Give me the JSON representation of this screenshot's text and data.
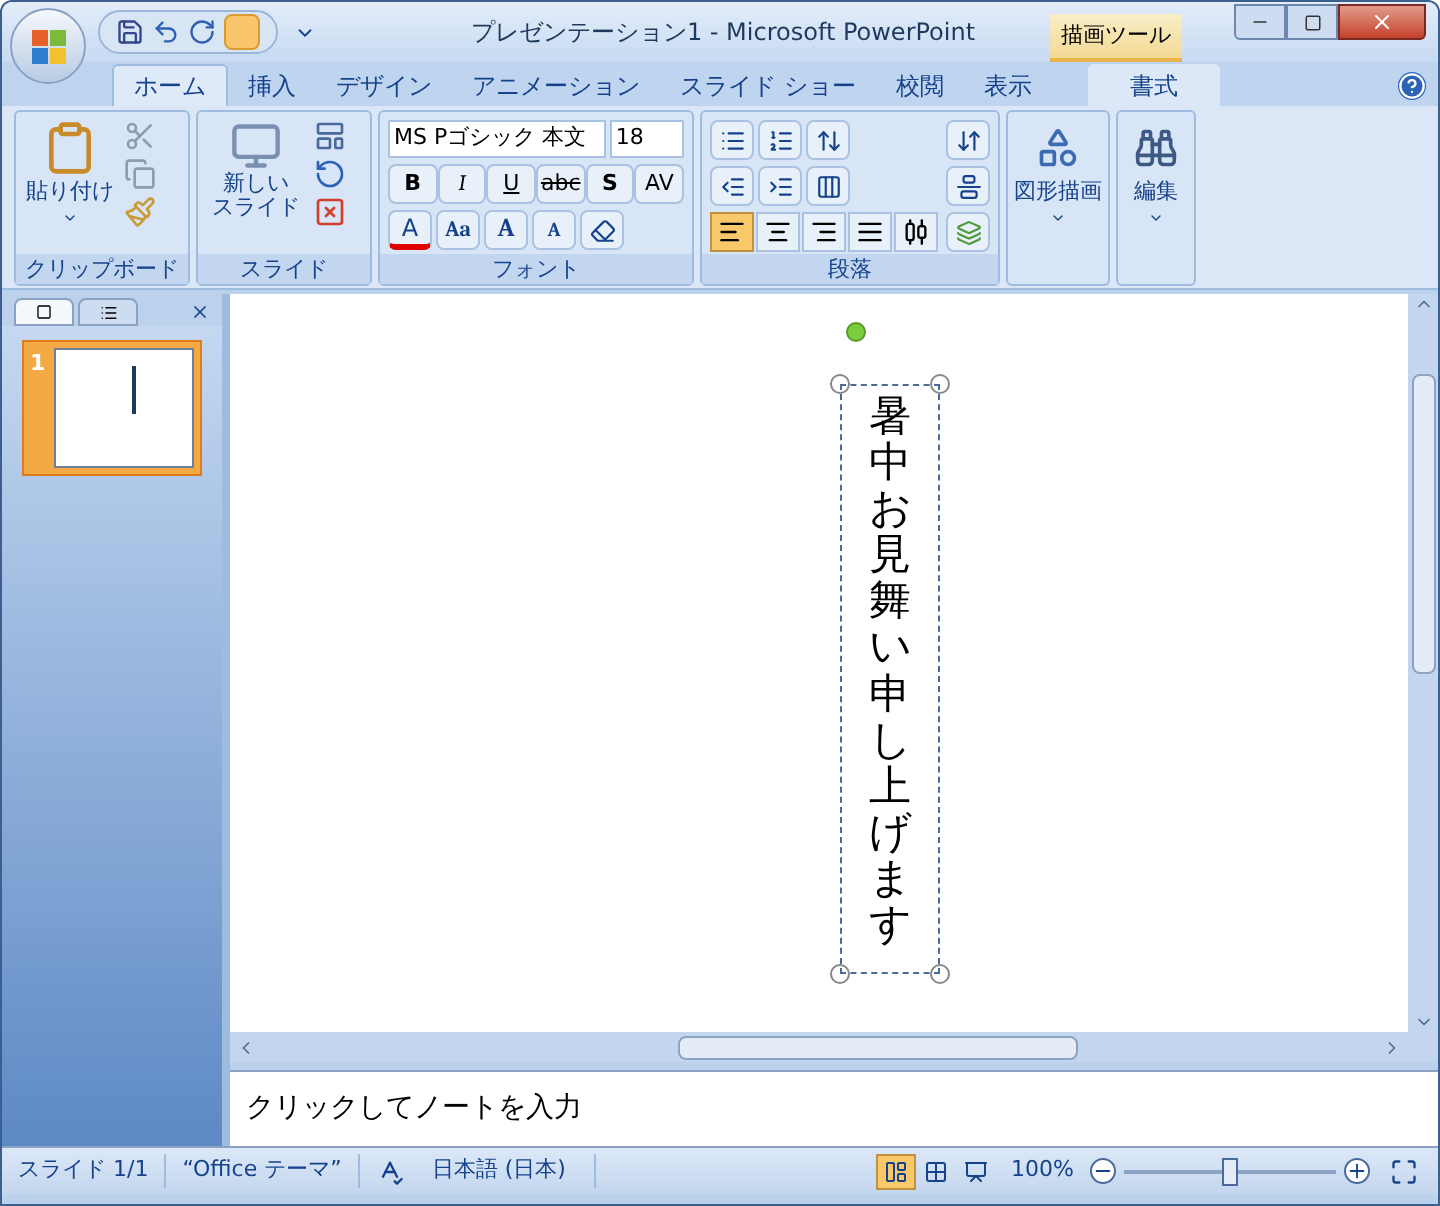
{
  "window": {
    "title": "プレゼンテーション1 - Microsoft PowerPoint",
    "context_group": "描画ツール"
  },
  "tabs": [
    {
      "label": "ホーム",
      "selected": true,
      "kind": "main"
    },
    {
      "label": "挿入",
      "selected": false,
      "kind": "main"
    },
    {
      "label": "デザイン",
      "selected": false,
      "kind": "main"
    },
    {
      "label": "アニメーション",
      "selected": false,
      "kind": "main"
    },
    {
      "label": "スライド ショー",
      "selected": false,
      "kind": "main"
    },
    {
      "label": "校閲",
      "selected": false,
      "kind": "main"
    },
    {
      "label": "表示",
      "selected": false,
      "kind": "main"
    },
    {
      "label": "書式",
      "selected": false,
      "kind": "contextual"
    }
  ],
  "ribbon": {
    "clipboard": {
      "label": "クリップボード",
      "paste": "貼り付け"
    },
    "slides": {
      "label": "スライド",
      "new_slide": "新しい",
      "new_slide_2": "スライド"
    },
    "font": {
      "label": "フォント",
      "font_name": "MS Pゴシック 本文",
      "font_size": "18",
      "style_buttons": [
        "B",
        "I",
        "U",
        "abc",
        "S",
        "AV"
      ],
      "color_button": "A",
      "case_button": "Aa",
      "grow_button": "A",
      "shrink_button": "A"
    },
    "paragraph": {
      "label": "段落",
      "alignment": [
        {
          "kind": "left",
          "selected": true
        },
        {
          "kind": "center",
          "selected": false
        },
        {
          "kind": "right",
          "selected": false
        },
        {
          "kind": "justify",
          "selected": false
        },
        {
          "kind": "distributed",
          "selected": false
        }
      ]
    },
    "drawing": {
      "label": "図形描画"
    },
    "editing": {
      "label": "編集"
    }
  },
  "slide_panel": {
    "thumbnails": [
      {
        "number": "1",
        "selected": true
      }
    ]
  },
  "slide": {
    "text_box": {
      "text": "暑中お見舞い申し上げます",
      "selected": true
    }
  },
  "notes": {
    "prompt": "クリックしてノートを入力"
  },
  "status_bar": {
    "slide": "スライド 1/1",
    "theme": "“Office テーマ”",
    "language": "日本語 (日本)",
    "views": [
      {
        "kind": "normal",
        "selected": true
      },
      {
        "kind": "sorter",
        "selected": false
      },
      {
        "kind": "show",
        "selected": false
      }
    ],
    "zoom": "100%",
    "zoom_slider": {
      "level": 0.5
    }
  }
}
